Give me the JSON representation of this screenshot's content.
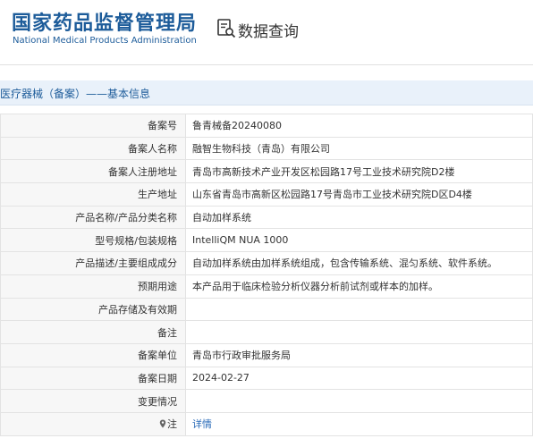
{
  "header": {
    "logo_cn": "国家药品监督管理局",
    "logo_en": "National Medical Products Administration",
    "query_title": "数据查询",
    "query_icon": "document-search-icon"
  },
  "section": {
    "title": "医疗器械（备案）——基本信息"
  },
  "rows": [
    {
      "label": "备案号",
      "value": "鲁青械备20240080"
    },
    {
      "label": "备案人名称",
      "value": "融智生物科技（青岛）有限公司"
    },
    {
      "label": "备案人注册地址",
      "value": "青岛市高新技术产业开发区松园路17号工业技术研究院D2楼"
    },
    {
      "label": "生产地址",
      "value": "山东省青岛市高新区松园路17号青岛市工业技术研究院D区D4楼"
    },
    {
      "label": "产品名称/产品分类名称",
      "value": "自动加样系统"
    },
    {
      "label": "型号规格/包装规格",
      "value": "IntelliQM NUA 1000"
    },
    {
      "label": "产品描述/主要组成成分",
      "value": "自动加样系统由加样系统组成，包含传输系统、混匀系统、软件系统。"
    },
    {
      "label": "预期用途",
      "value": "本产品用于临床检验分析仪器分析前试剂或样本的加样。"
    },
    {
      "label": "产品存储及有效期",
      "value": ""
    },
    {
      "label": "备注",
      "value": ""
    },
    {
      "label": "备案单位",
      "value": "青岛市行政审批服务局"
    },
    {
      "label": "备案日期",
      "value": "2024-02-27"
    },
    {
      "label": "变更情况",
      "value": ""
    },
    {
      "label": "注",
      "value": "详情"
    }
  ],
  "colors": {
    "brand_blue": "#1d5c9a",
    "link_blue": "#2a6bb8",
    "section_bg": "#e9f1fa"
  }
}
